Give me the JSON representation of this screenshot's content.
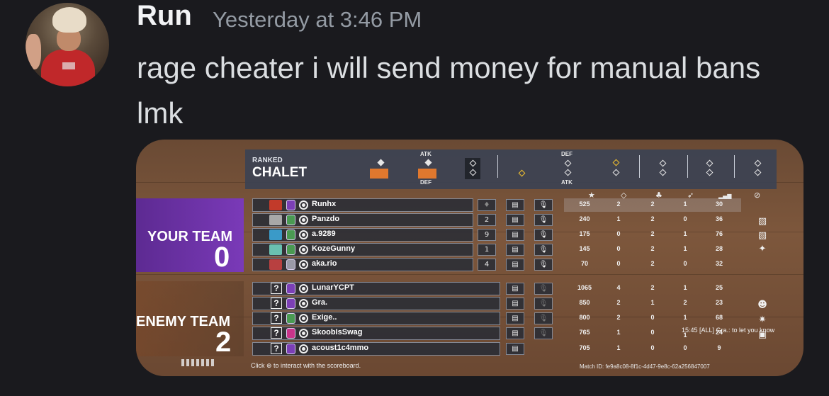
{
  "message": {
    "username": "Run",
    "timestamp": "Yesterday at 3:46 PM",
    "text": "rage cheater i will send money for manual bans lmk"
  },
  "attachment": {
    "ranked_label": "RANKED",
    "map_name": "CHALET",
    "atk_label": "ATK",
    "def_label": "DEF",
    "def_label_2": "DEF",
    "atk_label_2": "ATK",
    "your_team_label": "YOUR TEAM",
    "your_team_score": "0",
    "enemy_team_label": "ENEMY TEAM",
    "enemy_team_score": "2",
    "stat_headers": [
      "★",
      "◇",
      "♣",
      "➶",
      "▂▄▆",
      "⊘"
    ],
    "your_team": [
      {
        "name": "Runhx",
        "score": "525",
        "kills": "2",
        "deaths": "2",
        "assists": "1",
        "ping": "30"
      },
      {
        "name": "Panzdo",
        "score": "240",
        "kills": "1",
        "deaths": "2",
        "assists": "0",
        "ping": "36"
      },
      {
        "name": "a.9289",
        "score": "175",
        "kills": "0",
        "deaths": "2",
        "assists": "1",
        "ping": "76"
      },
      {
        "name": "KozeGunny",
        "score": "145",
        "kills": "0",
        "deaths": "2",
        "assists": "1",
        "ping": "28"
      },
      {
        "name": "aka.rio",
        "score": "70",
        "kills": "0",
        "deaths": "2",
        "assists": "0",
        "ping": "32"
      }
    ],
    "enemy_team": [
      {
        "name": "LunarYCPT",
        "score": "1065",
        "kills": "4",
        "deaths": "2",
        "assists": "1",
        "ping": "25"
      },
      {
        "name": "Gra.",
        "score": "850",
        "kills": "2",
        "deaths": "1",
        "assists": "2",
        "ping": "23"
      },
      {
        "name": "Exige..",
        "score": "800",
        "kills": "2",
        "deaths": "0",
        "assists": "1",
        "ping": "68"
      },
      {
        "name": "SkoobIsSwag",
        "score": "765",
        "kills": "1",
        "deaths": "0",
        "assists": "1",
        "ping": "24"
      },
      {
        "name": "acoust1c4mmo",
        "score": "705",
        "kills": "1",
        "deaths": "0",
        "assists": "0",
        "ping": "9"
      }
    ],
    "footer_text": "Click  ⊕  to interact with the scoreboard.",
    "match_id": "Match ID: fe9a8c08-8f1c-4d47-9e8c-62a256847007",
    "chat_line": "15:45   [ALL] Gra.: to let you know",
    "unknown_mark": "?",
    "row_badges": [
      "♦",
      "2",
      "9",
      "1",
      "4"
    ],
    "mic_icon": "🎙",
    "chat_icon": "▤"
  },
  "colors": {
    "background": "#1a1a1e",
    "your_team": "#7a3ab8",
    "round_win": "#e0782e",
    "highlight_yellow": "#f2c12e"
  }
}
